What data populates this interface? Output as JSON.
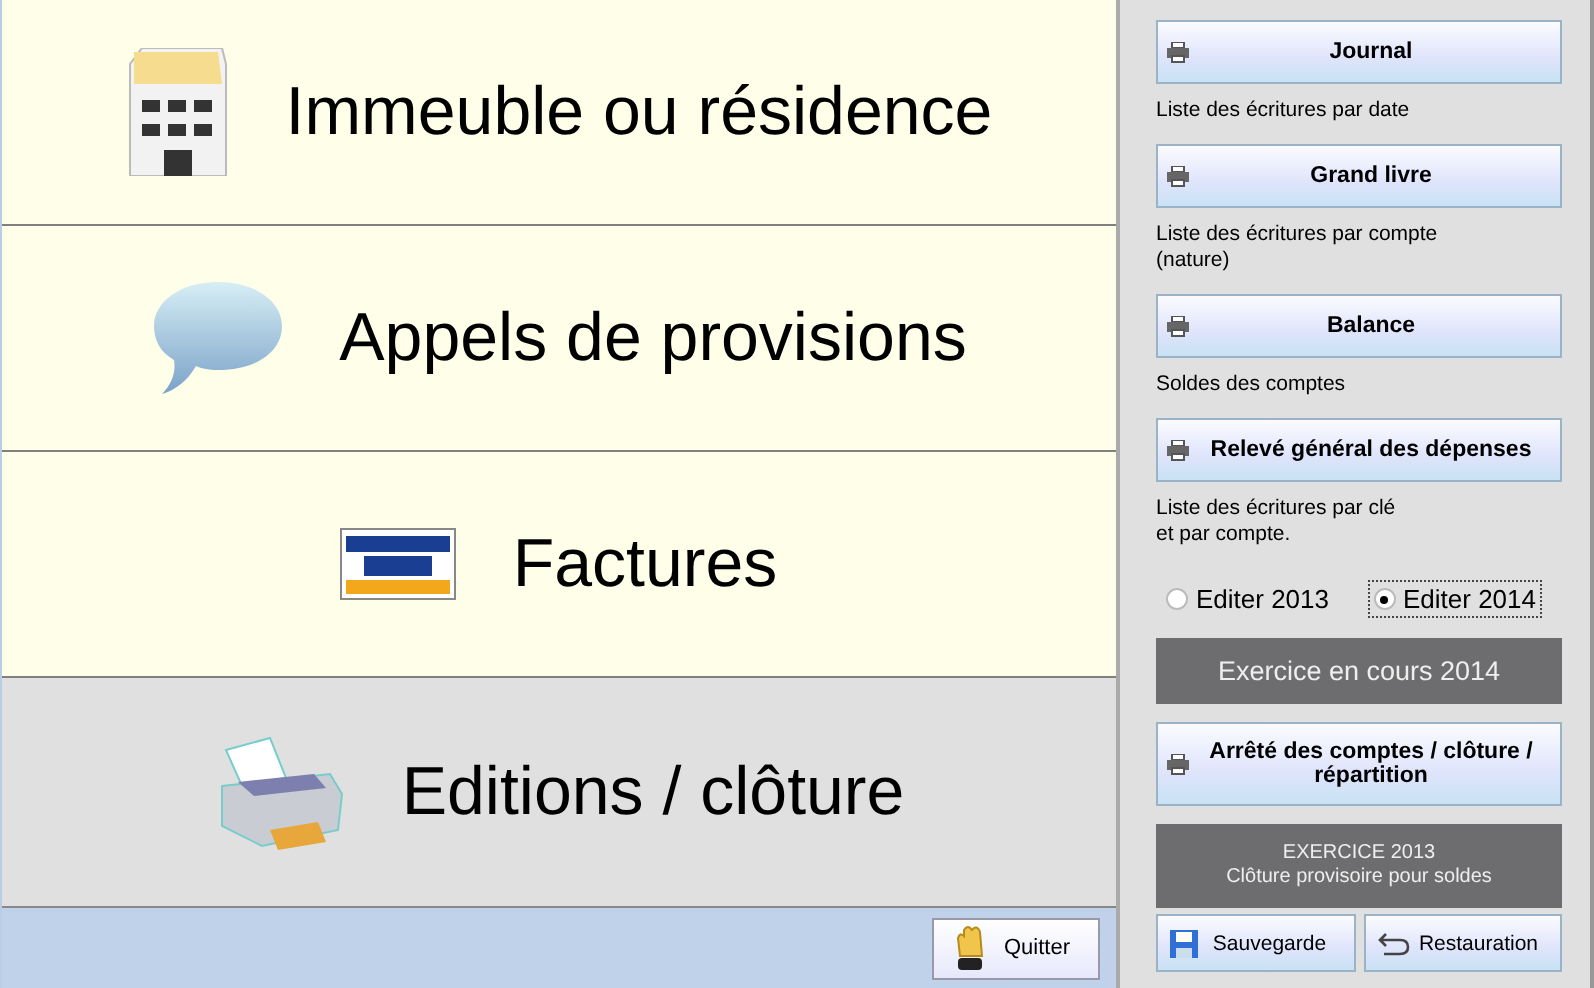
{
  "nav": [
    {
      "label": "Immeuble ou résidence",
      "kind": "building",
      "selected": false
    },
    {
      "label": "Appels de provisions",
      "kind": "messages",
      "selected": false
    },
    {
      "label": "Factures",
      "kind": "invoices",
      "selected": false
    },
    {
      "label": "Editions / clôture",
      "kind": "printing",
      "selected": true
    }
  ],
  "reports": [
    {
      "label": "Journal",
      "description": "Liste des écritures par date"
    },
    {
      "label": "Grand livre",
      "description": "Liste des écritures par compte\n(nature)"
    },
    {
      "label": "Balance",
      "description": "Soldes des comptes"
    },
    {
      "label": "Relevé général des dépenses",
      "description": "Liste des écritures par clé\net par compte."
    }
  ],
  "year_options": [
    {
      "label": "Editer 2013",
      "selected": false
    },
    {
      "label": "Editer 2014",
      "selected": true
    }
  ],
  "current_year_banner": "Exercice en cours 2014",
  "closing_button": "Arrêté des comptes / clôture / répartition",
  "closing_banner": {
    "title": "EXERCICE 2013",
    "subtitle": "Clôture provisoire pour soldes"
  },
  "backup_buttons": [
    {
      "label": "Sauvegarde",
      "kind": "save"
    },
    {
      "label": "Restauration",
      "kind": "restore"
    }
  ],
  "quit_button": "Quitter"
}
